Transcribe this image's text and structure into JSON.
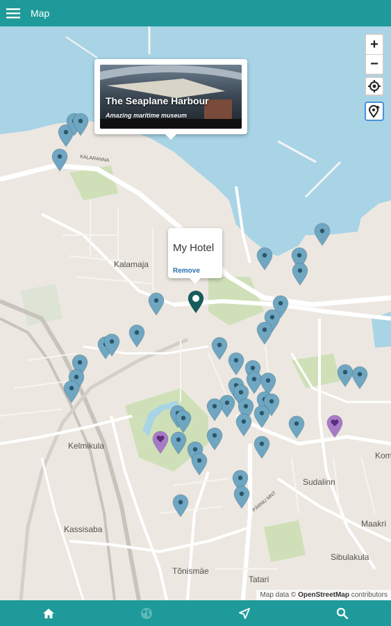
{
  "appbar": {
    "title": "Map"
  },
  "map": {
    "labels": {
      "kalamaja": "Kalamaja",
      "kelmikula": "Kelmikula",
      "kassisaba": "Kassisaba",
      "tonismae": "Tõnismäe",
      "tatari": "Tatari",
      "sudalinn": "Sudalinn",
      "sibulakula": "Sibulakula",
      "maakri": "Maakri",
      "kom": "Kom",
      "kalaranna_street": "KALARANNA",
      "paldiski_street": "PÄRNU MNT"
    },
    "seaplane_popup": {
      "title": "The Seaplane Harbour",
      "subtitle": "Amazing maritime museum"
    },
    "hotel_popup": {
      "title": "My Hotel",
      "remove_label": "Remove"
    },
    "zoom_in_label": "+",
    "zoom_out_label": "−",
    "attribution": {
      "prefix": "Map data ©",
      "source": "OpenStreetMap",
      "suffix": "contributors"
    },
    "colors": {
      "marker": "#6fa7c2",
      "marker_favorite": "#a87bc9",
      "marker_hotel": "#175c5c",
      "water": "#a8d4e6",
      "land": "#ece8e1",
      "park": "#cfe0b8",
      "toolbar": "#1f9a9a"
    }
  },
  "bottom_nav": {
    "items": [
      {
        "name": "home",
        "icon": "home-icon"
      },
      {
        "name": "globe",
        "icon": "globe-icon"
      },
      {
        "name": "navigate",
        "icon": "navigate-icon"
      },
      {
        "name": "search",
        "icon": "search-icon"
      }
    ]
  }
}
